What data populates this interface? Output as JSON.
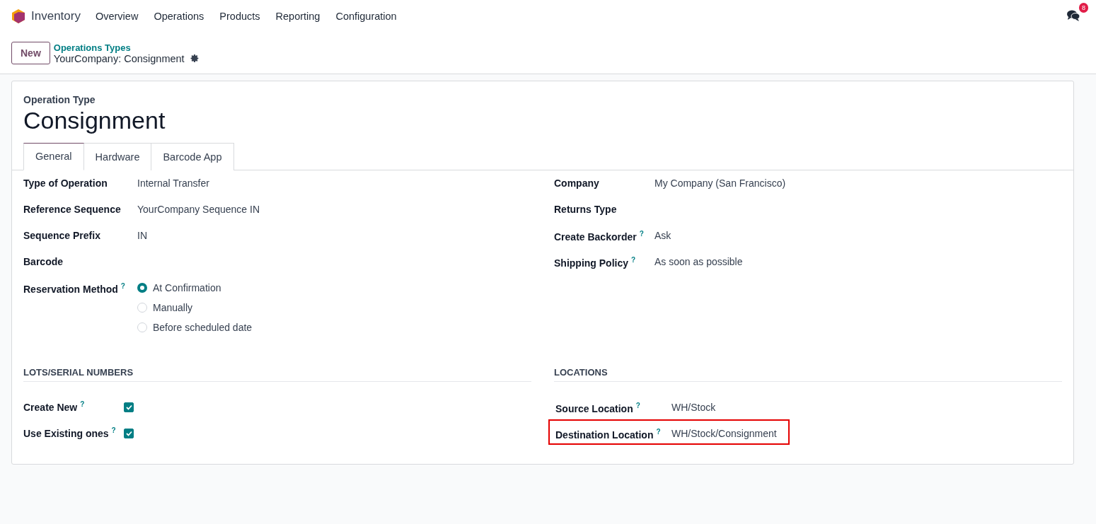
{
  "navbar": {
    "app_name": "Inventory",
    "menu": [
      "Overview",
      "Operations",
      "Products",
      "Reporting",
      "Configuration"
    ],
    "messages_badge": "8"
  },
  "control_panel": {
    "new_button": "New",
    "breadcrumb": "Operations Types",
    "record": "YourCompany: Consignment"
  },
  "form": {
    "overline": "Operation Type",
    "title": "Consignment",
    "tabs": [
      {
        "label": "General",
        "selected": true
      },
      {
        "label": "Hardware",
        "selected": false
      },
      {
        "label": "Barcode App",
        "selected": false
      }
    ],
    "left_fields": [
      {
        "kind": "text",
        "label": "Type of Operation",
        "value": "Internal Transfer"
      },
      {
        "kind": "text",
        "label": "Reference Sequence",
        "value": "YourCompany Sequence IN"
      },
      {
        "kind": "text",
        "label": "Sequence Prefix",
        "value": "IN"
      },
      {
        "kind": "text",
        "label": "Barcode"
      },
      {
        "kind": "radio",
        "label": "Reservation Method",
        "help": "?",
        "options": [
          {
            "label": "At Confirmation",
            "selected": true
          },
          {
            "label": "Manually",
            "selected": false
          },
          {
            "label": "Before scheduled date",
            "selected": false
          }
        ]
      }
    ],
    "right_fields": [
      {
        "kind": "text",
        "label": "Company",
        "value": "My Company (San Francisco)"
      },
      {
        "kind": "text",
        "label": "Returns Type"
      },
      {
        "kind": "text",
        "label": "Create Backorder",
        "help": "?",
        "value": "Ask"
      },
      {
        "kind": "text",
        "label": "Shipping Policy",
        "help": "?",
        "value": "As soon as possible"
      }
    ],
    "lots": {
      "heading": "LOTS/SERIAL NUMBERS",
      "fields": [
        {
          "kind": "checkbox",
          "label": "Create New",
          "help": "?",
          "checked": true
        },
        {
          "kind": "checkbox",
          "label": "Use Existing ones",
          "help": "?",
          "checked": true
        }
      ]
    },
    "locations": {
      "heading": "LOCATIONS",
      "fields": [
        {
          "kind": "text",
          "label": "Source Location",
          "help": "?",
          "value": "WH/Stock",
          "highlighted": false
        },
        {
          "kind": "text",
          "label": "Destination Location",
          "help": "?",
          "value": "WH/Stock/Consignment",
          "highlighted": true
        }
      ]
    }
  }
}
